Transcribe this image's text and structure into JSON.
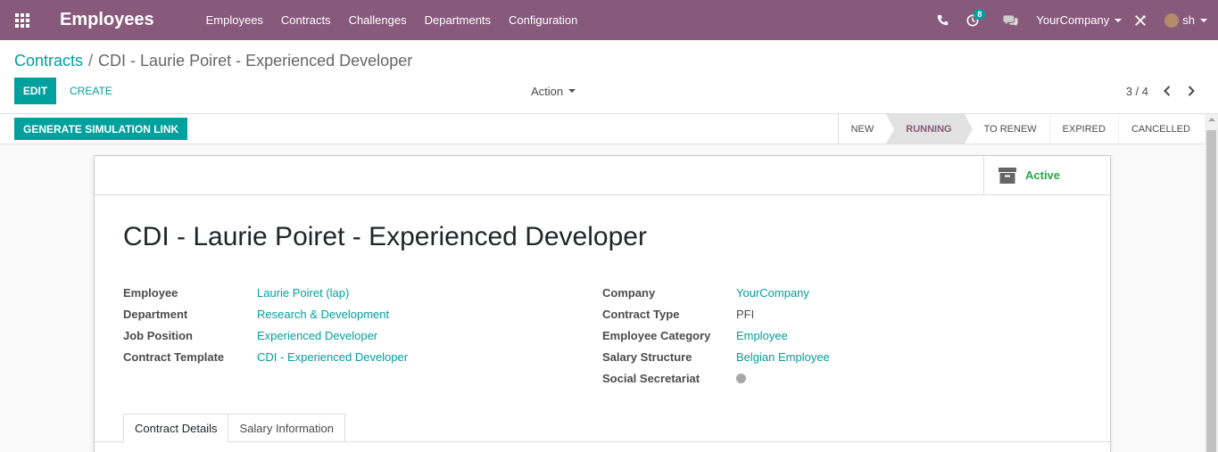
{
  "app": {
    "title": "Employees"
  },
  "menu": [
    "Employees",
    "Contracts",
    "Challenges",
    "Departments",
    "Configuration"
  ],
  "systray": {
    "activity_count": "8",
    "company": "YourCompany",
    "user": "sh"
  },
  "breadcrumb": {
    "parent": "Contracts",
    "separator": "/",
    "current": "CDI - Laurie Poiret - Experienced Developer"
  },
  "buttons": {
    "edit": "EDIT",
    "create": "CREATE",
    "action": "Action",
    "generate": "GENERATE SIMULATION LINK"
  },
  "pager": {
    "value": "3 / 4"
  },
  "stages": {
    "new": "NEW",
    "running": "RUNNING",
    "to_renew": "TO RENEW",
    "expired": "EXPIRED",
    "cancelled": "CANCELLED",
    "active_stage": "RUNNING"
  },
  "smart_button": {
    "label": "Active"
  },
  "form": {
    "title": "CDI - Laurie Poiret - Experienced Developer",
    "left": [
      {
        "label": "Employee",
        "value": "Laurie Poiret (lap)"
      },
      {
        "label": "Department",
        "value": "Research & Development"
      },
      {
        "label": "Job Position",
        "value": "Experienced Developer"
      },
      {
        "label": "Contract Template",
        "value": "CDI - Experienced Developer"
      }
    ],
    "right": [
      {
        "label": "Company",
        "value": "YourCompany"
      },
      {
        "label": "Contract Type",
        "value": "PFI"
      },
      {
        "label": "Employee Category",
        "value": "Employee"
      },
      {
        "label": "Salary Structure",
        "value": "Belgian Employee"
      },
      {
        "label": "Social Secretariat",
        "value": ""
      }
    ],
    "tabs": [
      "Contract Details",
      "Salary Information"
    ]
  },
  "colors": {
    "brand": "#875a7b",
    "accent": "#00a09d",
    "active": "#28a745"
  }
}
